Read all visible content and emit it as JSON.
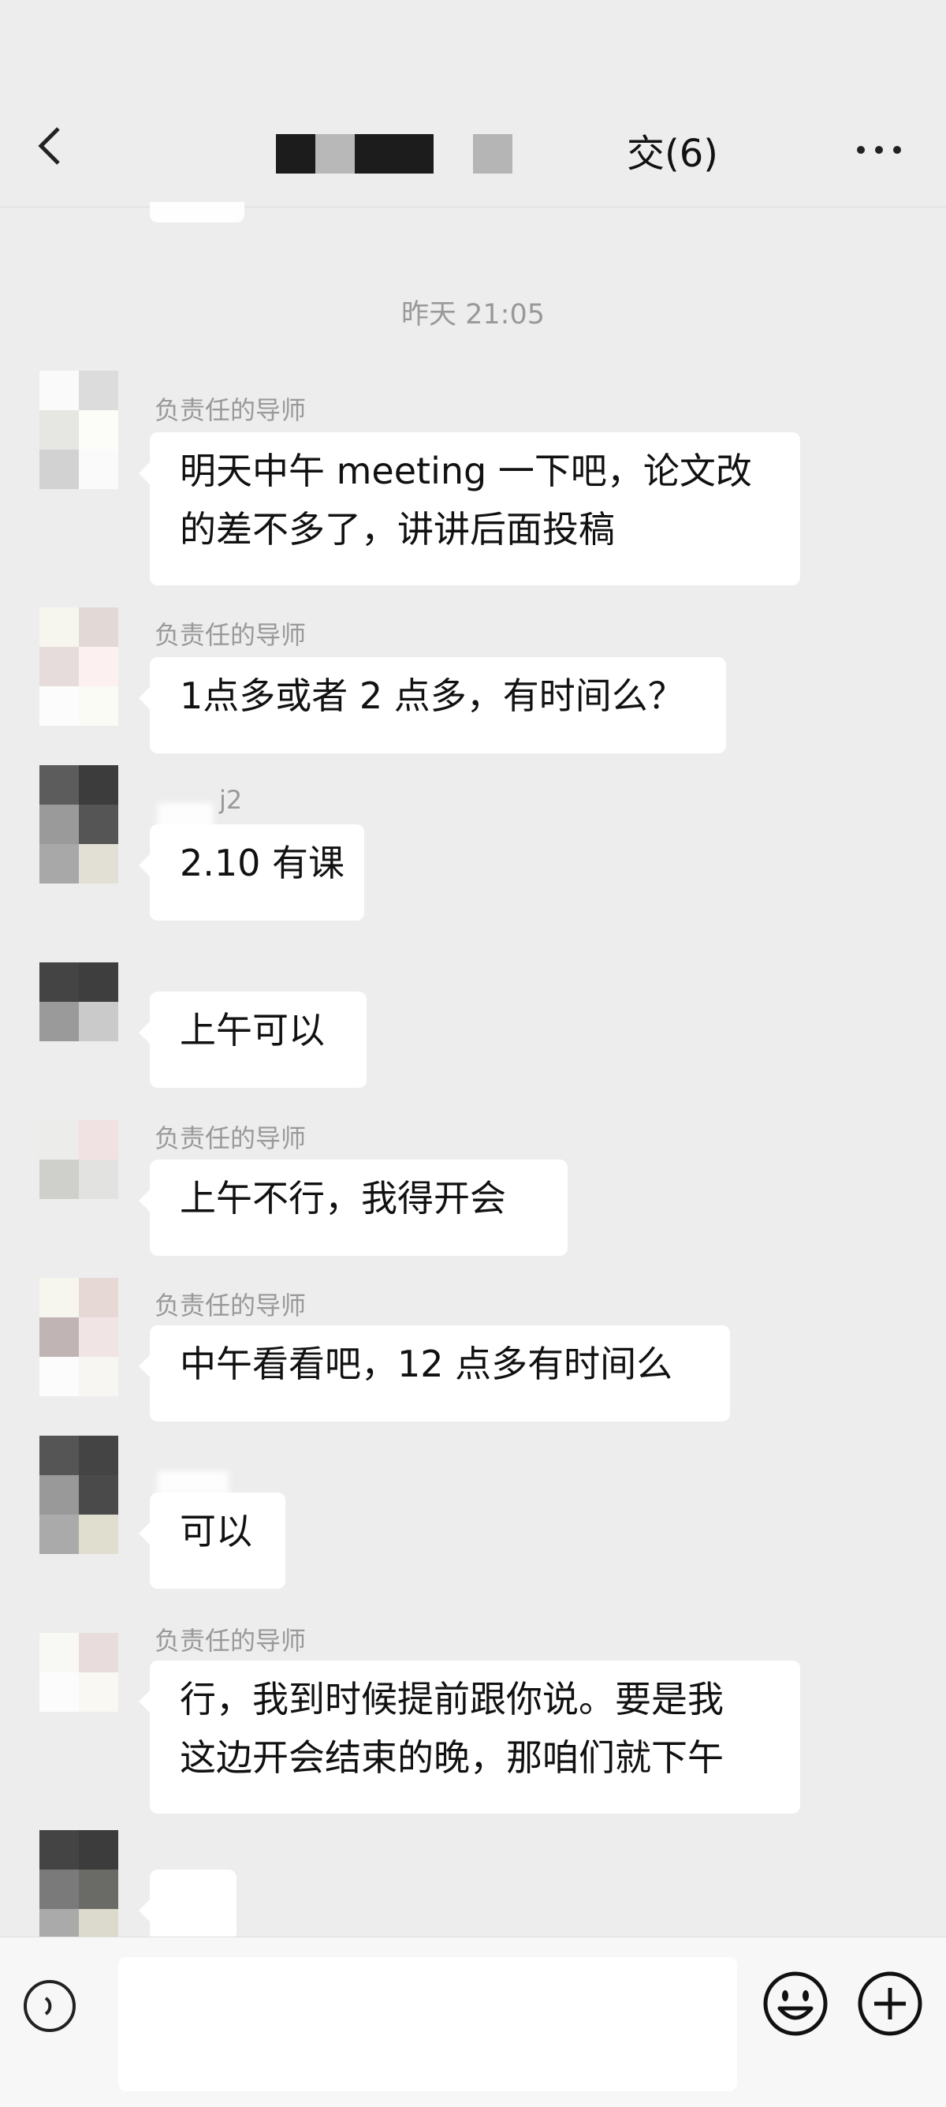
{
  "header": {
    "title_suffix": "交(6)",
    "back_icon": "chevron-left-icon",
    "more_icon": "more-icon"
  },
  "chat": {
    "timestamp": "昨天 21:05",
    "messages": [
      {
        "sender": "负责任的导师",
        "lines": [
          "明天中午 meeting 一下吧，论文改",
          "的差不多了，讲讲后面投稿"
        ]
      },
      {
        "sender": "负责任的导师",
        "lines": [
          "1点多或者 2 点多，有时间么？"
        ]
      },
      {
        "sender": "j2",
        "lines": [
          "2.10 有课"
        ]
      },
      {
        "sender": "",
        "lines": [
          "上午可以"
        ]
      },
      {
        "sender": "负责任的导师",
        "lines": [
          "上午不行，我得开会"
        ]
      },
      {
        "sender": "负责任的导师",
        "lines": [
          "中午看看吧，12 点多有时间么"
        ]
      },
      {
        "sender": "",
        "lines": [
          "可以"
        ]
      },
      {
        "sender": "负责任的导师",
        "lines": [
          "行，我到时候提前跟你说。要是我",
          "这边开会结束的晚，那咱们就下午"
        ]
      },
      {
        "sender": "",
        "lines": [
          ""
        ]
      }
    ]
  },
  "input_bar": {
    "input_value": "",
    "voice_icon": "voice-icon",
    "emoji_icon": "emoji-icon",
    "plus_icon": "plus-icon"
  }
}
